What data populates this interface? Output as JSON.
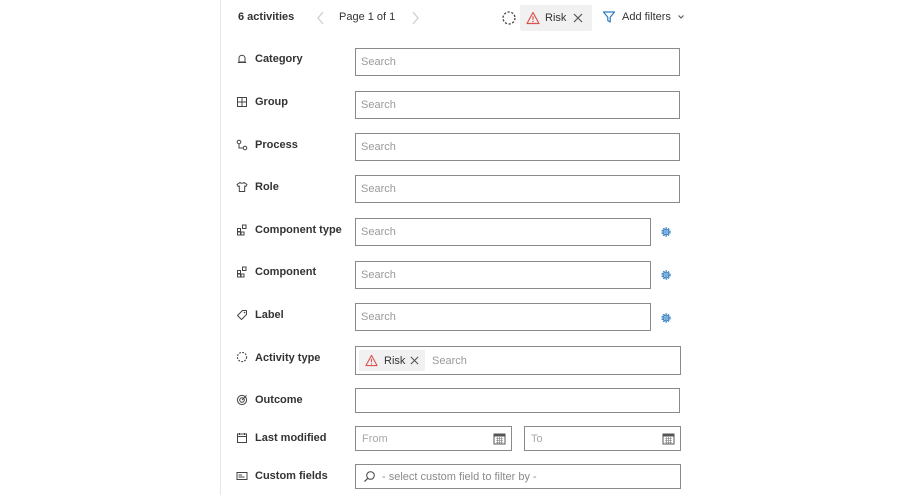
{
  "toolbar": {
    "count_label": "6 activities",
    "page_label": "Page 1 of 1",
    "active_filter": "Risk",
    "add_filters_label": "Add filters"
  },
  "rows": {
    "category": {
      "label": "Category",
      "placeholder": "Search"
    },
    "group": {
      "label": "Group",
      "placeholder": "Search"
    },
    "process": {
      "label": "Process",
      "placeholder": "Search"
    },
    "role": {
      "label": "Role",
      "placeholder": "Search"
    },
    "component_type": {
      "label": "Component type",
      "placeholder": "Search"
    },
    "component": {
      "label": "Component",
      "placeholder": "Search"
    },
    "label": {
      "label": "Label",
      "placeholder": "Search"
    },
    "activity_type": {
      "label": "Activity type",
      "chip": "Risk",
      "placeholder": "Search"
    },
    "outcome": {
      "label": "Outcome",
      "value": ""
    },
    "last_modified": {
      "label": "Last modified",
      "from_placeholder": "From",
      "to_placeholder": "To"
    },
    "custom_fields": {
      "label": "Custom fields",
      "placeholder": "- select custom field to filter by -"
    }
  },
  "colors": {
    "accent": "#2b7bbf",
    "warning": "#d9534f",
    "border": "#8a8a8a"
  },
  "icons": {
    "category": "bell-icon",
    "group": "grid-icon",
    "process": "process-icon",
    "role": "shirt-icon",
    "component_type": "components-icon",
    "component": "components-icon",
    "label": "tag-icon",
    "activity_type": "activity-icon",
    "outcome": "target-icon",
    "last_modified": "calendar-icon",
    "custom_fields": "custom-field-icon"
  }
}
